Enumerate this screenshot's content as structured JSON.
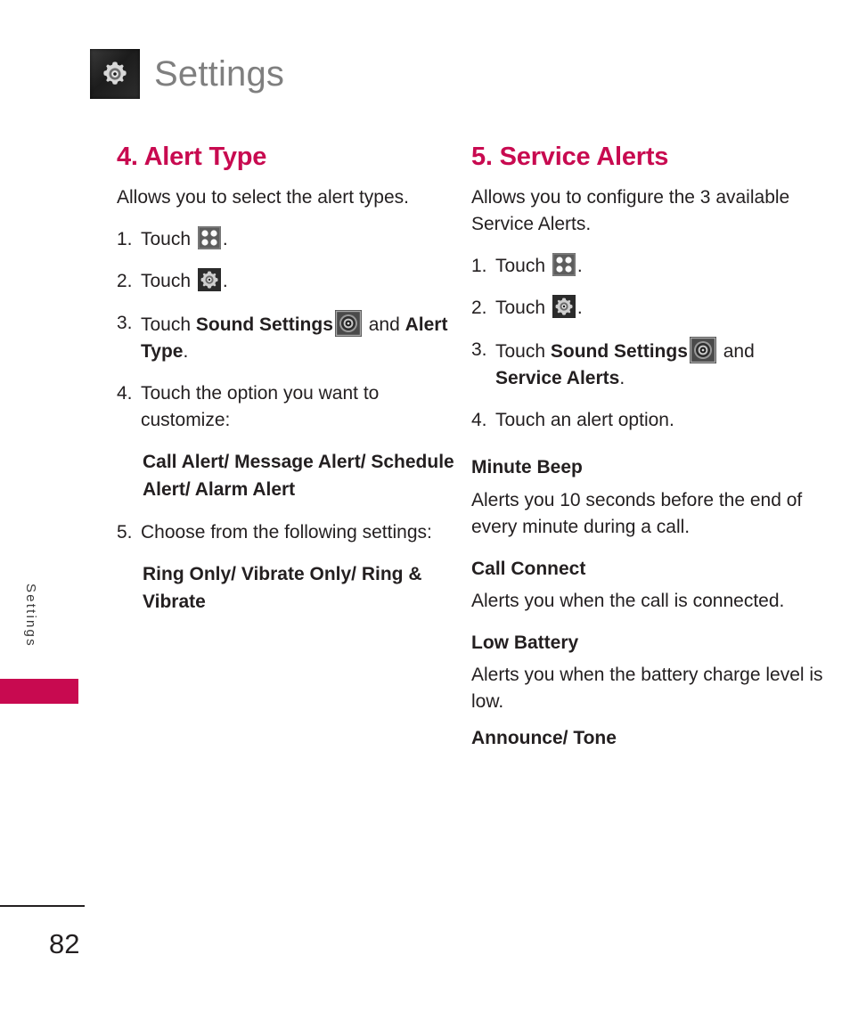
{
  "header": {
    "title": "Settings",
    "icon": "gear-icon"
  },
  "side_tab": {
    "label": "Settings"
  },
  "footer": {
    "page_number": "82"
  },
  "colors": {
    "accent": "#c80a50",
    "header_title": "#7f7f7f",
    "body_text": "#231f20"
  },
  "left_column": {
    "title": "4. Alert Type",
    "intro": "Allows you to select the alert types.",
    "steps": [
      {
        "num": "1.",
        "text_before": "Touch ",
        "icon": "grid-menu-icon",
        "text_after": ".",
        "bold_before": "",
        "bold_after": ""
      },
      {
        "num": "2.",
        "text_before": "Touch ",
        "icon": "gear-icon",
        "text_after": ".",
        "bold_before": "",
        "bold_after": ""
      },
      {
        "num": "3.",
        "text_before": "Touch ",
        "bold_before": "Sound Settings",
        "icon": "speaker-sound-icon",
        "text_after": " and ",
        "bold_after": "Alert Type",
        "text_end": "."
      },
      {
        "num": "4.",
        "text_before": "Touch the option you want to customize:",
        "icon": "",
        "text_after": ""
      }
    ],
    "options_1": "Call Alert/ Message Alert/ Schedule Alert/ Alarm Alert",
    "step_5_num": "5.",
    "step_5_text": "Choose from the following settings:",
    "options_2": "Ring Only/ Vibrate Only/ Ring & Vibrate"
  },
  "right_column": {
    "title": "5. Service Alerts",
    "intro": "Allows you to configure the 3 available Service Alerts.",
    "steps": [
      {
        "num": "1.",
        "text_before": "Touch ",
        "icon": "grid-menu-icon",
        "text_after": "."
      },
      {
        "num": "2.",
        "text_before": "Touch ",
        "icon": "gear-icon",
        "text_after": "."
      },
      {
        "num": "3.",
        "text_before": "Touch ",
        "bold_before": "Sound Settings",
        "icon": "speaker-sound-icon",
        "text_after": " and ",
        "bold_after": "Service Alerts",
        "text_end": "."
      },
      {
        "num": "4.",
        "text_before": "Touch an alert option.",
        "icon": "",
        "text_after": ""
      }
    ],
    "alerts": [
      {
        "name": "Minute Beep",
        "description": "Alerts you 10 seconds before the end of every minute during a call."
      },
      {
        "name": "Call Connect",
        "description": "Alerts you when the call is connected."
      },
      {
        "name": "Low Battery",
        "description": "Alerts you when the battery charge level is low."
      }
    ],
    "announce_tone": "Announce/ Tone"
  }
}
